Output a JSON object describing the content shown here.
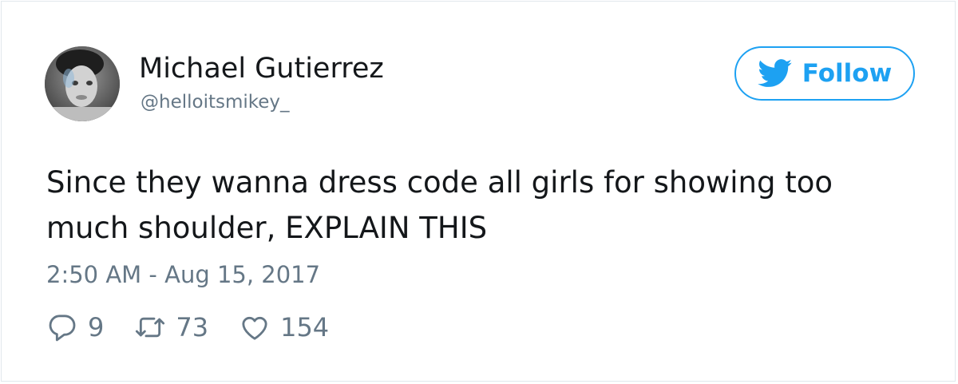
{
  "tweet": {
    "author": {
      "display_name": "Michael Gutierrez",
      "handle": "@helloitsmikey_"
    },
    "follow_label": "Follow",
    "text": "Since they wanna dress code all girls for showing too much shoulder, EXPLAIN THIS",
    "timestamp": "2:50 AM - Aug 15, 2017",
    "actions": {
      "replies": "9",
      "retweets": "73",
      "likes": "154"
    }
  },
  "colors": {
    "accent": "#1da1f2",
    "text_primary": "#14171a",
    "text_secondary": "#657786",
    "border": "#e1e8ed"
  },
  "icons": {
    "follow": "twitter-bird-icon",
    "reply": "reply-icon",
    "retweet": "retweet-icon",
    "like": "heart-icon"
  }
}
